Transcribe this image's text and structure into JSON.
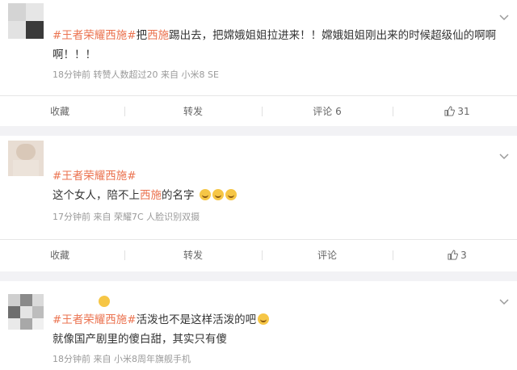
{
  "posts": [
    {
      "tag": "#王者荣耀西施#",
      "seg1": "把",
      "hl1": "西施",
      "seg2": "踢出去，把嫦娥姐姐拉进来！！嫦娥姐姐刚出来的时候超级仙的啊啊",
      "line2": "啊！！！",
      "meta": "18分钟前 转赞人数超过20 来自 小米8 SE",
      "actions": {
        "fav": "收藏",
        "repost": "转发",
        "comment": "评论 6",
        "like": "31"
      }
    },
    {
      "tag": "#王者荣耀西施#",
      "seg1": "这个女人，陪不上",
      "hl1": "西施",
      "seg2": "的名字",
      "meta": "17分钟前 来自 荣耀7C 人脸识别双摄",
      "actions": {
        "fav": "收藏",
        "repost": "转发",
        "comment": "评论",
        "like": "3"
      }
    },
    {
      "tag": "#王者荣耀西施#",
      "seg1": "活泼也不是这样活泼的吧",
      "line2": "就像国产剧里的傻白甜，其实只有傻",
      "meta": "18分钟前 来自 小米8周年旗舰手机"
    }
  ],
  "colors": {
    "accent": "#eb7350",
    "meta": "#9a9a9a",
    "divider": "#f2f2f5"
  },
  "icons": [
    "chevron-down-icon",
    "thumbs-up-icon",
    "laugh-cry-emoji-icon",
    "sweat-smile-emoji-icon",
    "crown-emoji-icon"
  ]
}
